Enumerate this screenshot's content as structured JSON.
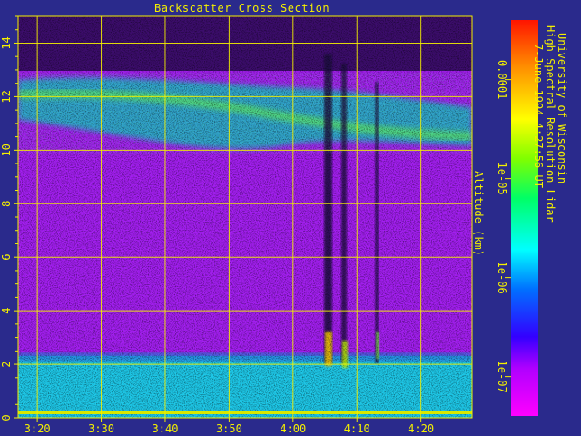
{
  "chart_data": {
    "type": "heatmap",
    "title": "Backscatter Cross Section",
    "xlabel": "",
    "ylabel": "Altitude (km)",
    "x_ticks": [
      "3:20",
      "3:30",
      "3:40",
      "3:50",
      "4:00",
      "4:10",
      "4:20"
    ],
    "xlim": [
      "3:17",
      "4:28"
    ],
    "y_ticks": [
      "0",
      "2",
      "4",
      "6",
      "8",
      "10",
      "12",
      "14"
    ],
    "ylim": [
      0,
      15
    ],
    "grid": true,
    "colorbar": {
      "scale": "log",
      "range": [
        4e-08,
        0.0004
      ],
      "tick_labels": [
        "1e-07",
        "1e-06",
        "1e-05",
        "0.0001"
      ],
      "tick_values": [
        1e-07,
        1e-06,
        1e-05,
        0.0001
      ],
      "colors": [
        "#ff00ff",
        "#9b00ff",
        "#3300ff",
        "#00a8ff",
        "#00ffff",
        "#00ff55",
        "#a0ff00",
        "#ffff00",
        "#ff9000",
        "#ff1a00"
      ]
    },
    "layers": [
      {
        "altitude_km": [
          0,
          2.2
        ],
        "level": "~3e-06"
      },
      {
        "altitude_km": [
          10.2,
          12.8
        ],
        "level": "~1e-05"
      }
    ],
    "source_lines": [
      "University of Wisconsin",
      "High Spectral Resolution Lidar",
      "7-June-1994  4:27:56 UT"
    ]
  },
  "colors": {
    "background": "#2a2a8c",
    "axis_text": "#f4f000",
    "grid": "#f4f000"
  }
}
